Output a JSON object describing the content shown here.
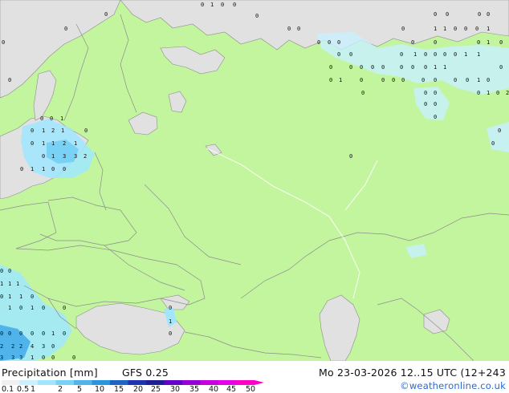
{
  "title": {
    "label": "Precipitation [mm]",
    "model": "GFS 0.25",
    "valid_time": "Mo 23-03-2026 12..15 UTC (12+243",
    "credit": "©weatheronline.co.uk"
  },
  "legend": {
    "ticks": [
      "0.1",
      "0.5",
      "1",
      "2",
      "5",
      "10",
      "15",
      "20",
      "25",
      "30",
      "35",
      "40",
      "45",
      "50"
    ],
    "colors": [
      "#f0f0f0",
      "#c8f0ff",
      "#a0e6ff",
      "#78d2f5",
      "#50b4eb",
      "#2896dc",
      "#1e64c8",
      "#1e32b4",
      "#1e1e96",
      "#6400c8",
      "#9600d2",
      "#c800dc",
      "#e600e6",
      "#ff00c8"
    ]
  },
  "colors": {
    "land": "#c3f59e",
    "sea": "#e1e1e1",
    "border": "#8c8c8c",
    "precip_light": "#c8f0ff",
    "precip_mid": "#a0e6ff",
    "precip_heavy": "#50b4eb"
  },
  "map_values": [
    "0",
    "1",
    "2",
    "3",
    "4"
  ]
}
